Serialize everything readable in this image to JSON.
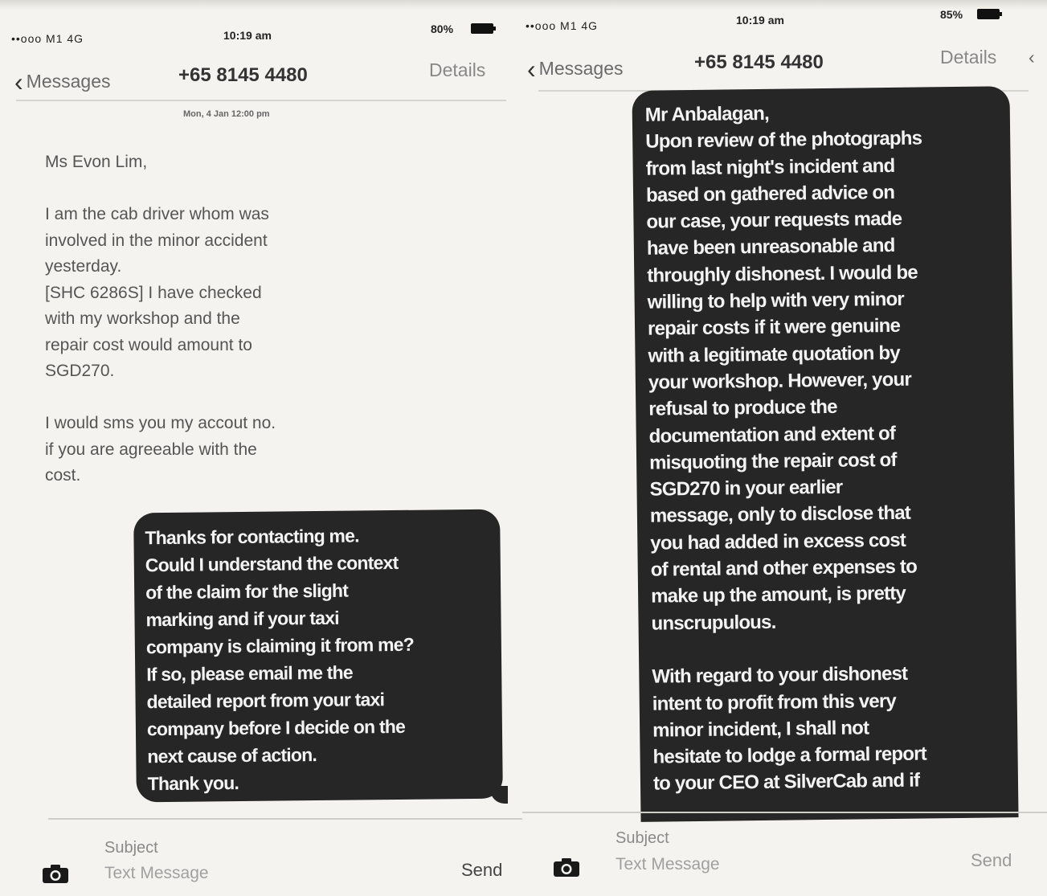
{
  "left_screen": {
    "status": {
      "carrier": "••ooo M1 4G",
      "time": "10:19 am",
      "battery": "80%"
    },
    "nav": {
      "back_label": "Messages",
      "contact": "+65 8145 4480",
      "details_label": "Details"
    },
    "timestamp": "Mon, 4 Jan 12:00 pm",
    "incoming_message": "Ms Evon Lim,\n\nI am the cab driver whom was\ninvolved in the minor accident\nyesterday.\n[SHC 6286S] I have checked\nwith my workshop and the\nrepair cost would amount to\nSGD270.\n\nI would sms you my accout no.\nif you are agreeable with the\ncost.",
    "outgoing_message": "Thanks for contacting me.\nCould I understand the context\nof the claim for the slight\nmarking and if your taxi\ncompany is claiming it from me?\nIf so, please email me the\ndetailed report from your taxi\ncompany before I decide on the\nnext cause of action.\nThank you.",
    "input": {
      "subject_placeholder": "Subject",
      "message_placeholder": "Text Message",
      "send_label": "Send"
    },
    "send_color": "#444444"
  },
  "right_screen": {
    "status": {
      "carrier": "••ooo M1 4G",
      "time": "10:19 am",
      "battery": "85%"
    },
    "nav": {
      "back_label": "Messages",
      "contact": "+65 8145 4480",
      "details_label": "Details"
    },
    "outgoing_message": "Mr Anbalagan,\nUpon review of the photographs\nfrom last night's incident and\nbased on gathered advice on\nour case, your requests made\nhave been unreasonable and\nthroughly dishonest. I would be\nwilling to help with very minor\nrepair costs if it were genuine\nwith a legitimate quotation by\nyour workshop. However, your\nrefusal to produce the\ndocumentation and extent of\nmisquoting the repair cost of\nSGD270 in your earlier\nmessage, only to disclose that\nyou had added in excess cost\nof rental and other expenses to\nmake up the amount, is pretty\nunscrupulous.\n\nWith regard to your dishonest\nintent to profit from this very\nminor incident, I shall not\nhesitate to lodge a formal report\nto your CEO at SilverCab and if",
    "input": {
      "subject_placeholder": "Subject",
      "message_placeholder": "Text Message",
      "send_label": "Send"
    },
    "send_color": "#9a9a9a"
  },
  "colors": {
    "bubble": "#262626",
    "background": "#f4f3ef"
  }
}
